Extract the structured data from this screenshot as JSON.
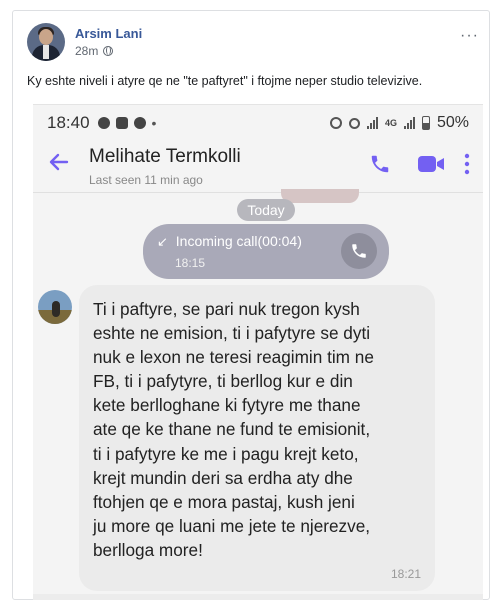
{
  "post": {
    "author": "Arsim Lani",
    "time": "28m",
    "privacy_icon": "globe-icon",
    "more_icon": "···",
    "caption": "Ky eshte niveli i atyre qe ne \"te paftyret\" i ftojme neper studio televizive."
  },
  "phone": {
    "status_bar": {
      "time": "18:40",
      "network": "4G",
      "battery": "50%"
    },
    "chat": {
      "contact_name": "Melihate Termkolli",
      "last_seen": "Last seen 11 min ago",
      "day_label": "Today",
      "call": {
        "label": "Incoming call(00:04)",
        "time": "18:15"
      },
      "message": {
        "lines": [
          "Ti i paftyre, se pari nuk tregon kysh",
          "eshte ne emision, ti i pafytyre se dyti",
          "nuk e lexon ne teresi reagimin tim ne",
          "FB, ti i pafytyre, ti berllog kur e din",
          "kete berlloghane ki fytyre me thane",
          "ate qe ke thane ne fund te emisionit,",
          "ti i pafytyre ke me i pagu krejt keto,",
          "krejt mundin deri sa erdha aty dhe",
          "ftohjen qe e mora pastaj, kush jeni",
          "ju more qe luani me jete te njerezve,",
          "berlloga more!"
        ],
        "time": "18:21"
      }
    }
  },
  "colors": {
    "author_link": "#385898",
    "accent_purple": "#7360f2",
    "call_bubble": "#a9a9b8",
    "incoming_bubble": "#ebebeb"
  }
}
